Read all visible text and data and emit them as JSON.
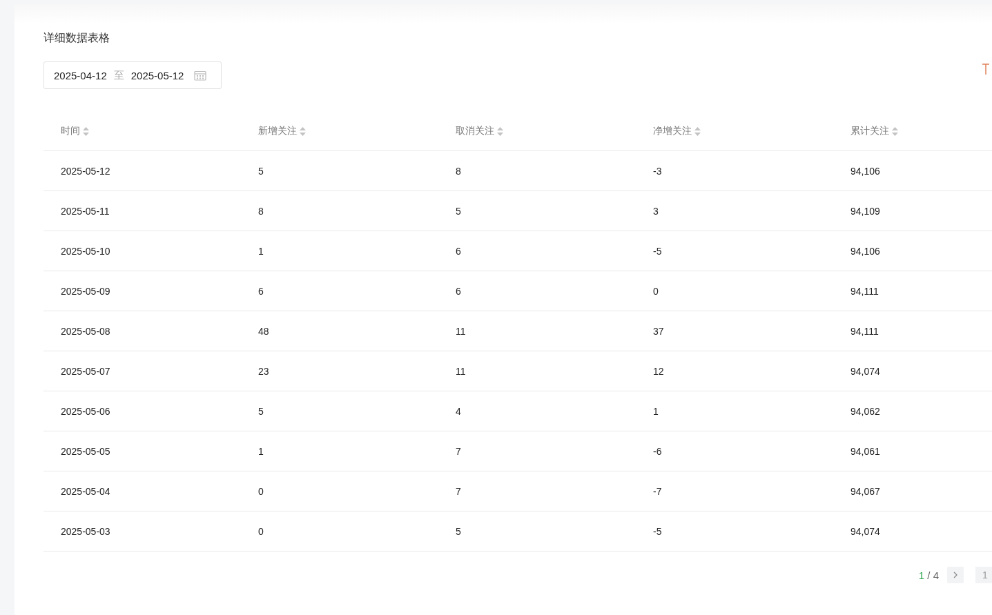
{
  "section_title": "详细数据表格",
  "date_range": {
    "start": "2025-04-12",
    "separator": "至",
    "end": "2025-05-12"
  },
  "table": {
    "columns": [
      "时间",
      "新增关注",
      "取消关注",
      "净增关注",
      "累计关注"
    ],
    "rows": [
      [
        "2025-05-12",
        "5",
        "8",
        "-3",
        "94,106"
      ],
      [
        "2025-05-11",
        "8",
        "5",
        "3",
        "94,109"
      ],
      [
        "2025-05-10",
        "1",
        "6",
        "-5",
        "94,106"
      ],
      [
        "2025-05-09",
        "6",
        "6",
        "0",
        "94,111"
      ],
      [
        "2025-05-08",
        "48",
        "11",
        "37",
        "94,111"
      ],
      [
        "2025-05-07",
        "23",
        "11",
        "12",
        "94,074"
      ],
      [
        "2025-05-06",
        "5",
        "4",
        "1",
        "94,062"
      ],
      [
        "2025-05-05",
        "1",
        "7",
        "-6",
        "94,061"
      ],
      [
        "2025-05-04",
        "0",
        "7",
        "-7",
        "94,067"
      ],
      [
        "2025-05-03",
        "0",
        "5",
        "-5",
        "94,074"
      ]
    ]
  },
  "pagination": {
    "current": "1",
    "separator": "/",
    "total": "4",
    "jump_value": "1"
  }
}
